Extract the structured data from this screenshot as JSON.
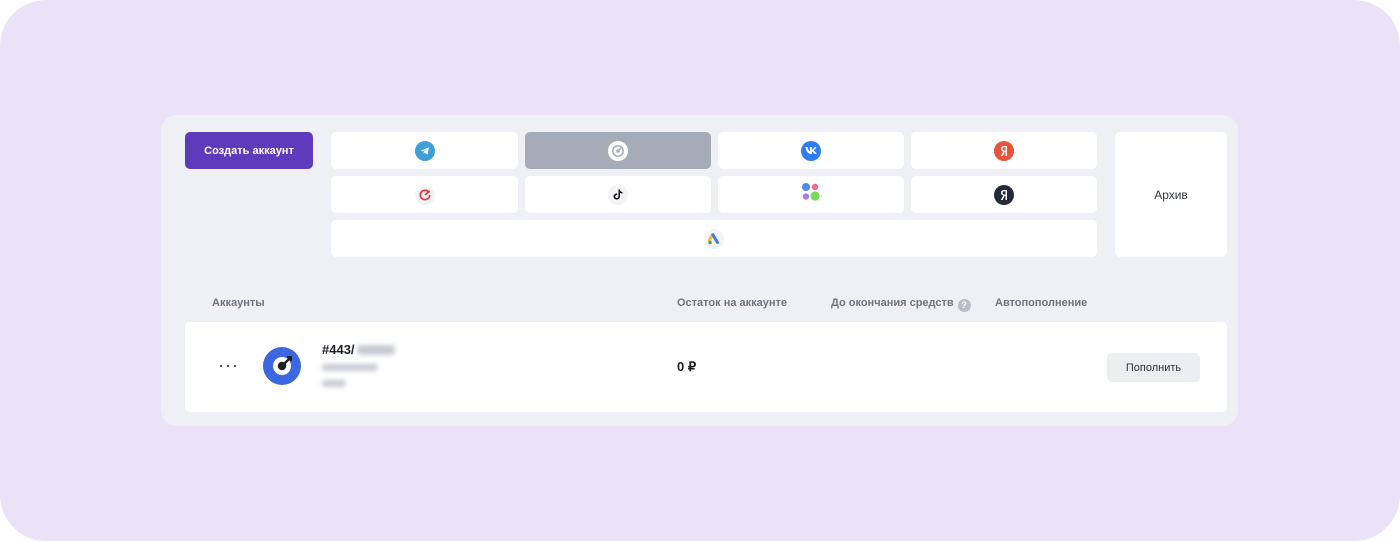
{
  "toolbar": {
    "create_label": "Создать аккаунт",
    "archive_label": "Архив"
  },
  "platforms": [
    {
      "icon": "telegram-icon",
      "color": "#3d9ed8"
    },
    {
      "icon": "target-ads-icon",
      "color": "#ffffff",
      "active": true
    },
    {
      "icon": "vk-icon",
      "color": "#2e7df6"
    },
    {
      "icon": "yandex-direct-icon",
      "color": "#e8533a"
    },
    {
      "icon": "mytarget-icon",
      "color": "#e23b3b"
    },
    {
      "icon": "tiktok-icon",
      "color": "#111111"
    },
    {
      "icon": "vk-ads-dots-icon",
      "color": "#4f87f3"
    },
    {
      "icon": "yandex-icon",
      "color": "#252a3a"
    },
    {
      "icon": "google-ads-icon",
      "color": "#3c7de6"
    }
  ],
  "table": {
    "headers": {
      "accounts": "Аккаунты",
      "balance": "Остаток на аккаунте",
      "until_end": "До окончания средств",
      "help": "?",
      "autopay": "Автопополнение"
    },
    "rows": [
      {
        "menu": "···",
        "id": "#443/",
        "balance": "0 ₽",
        "topup_label": "Пополнить"
      }
    ]
  }
}
